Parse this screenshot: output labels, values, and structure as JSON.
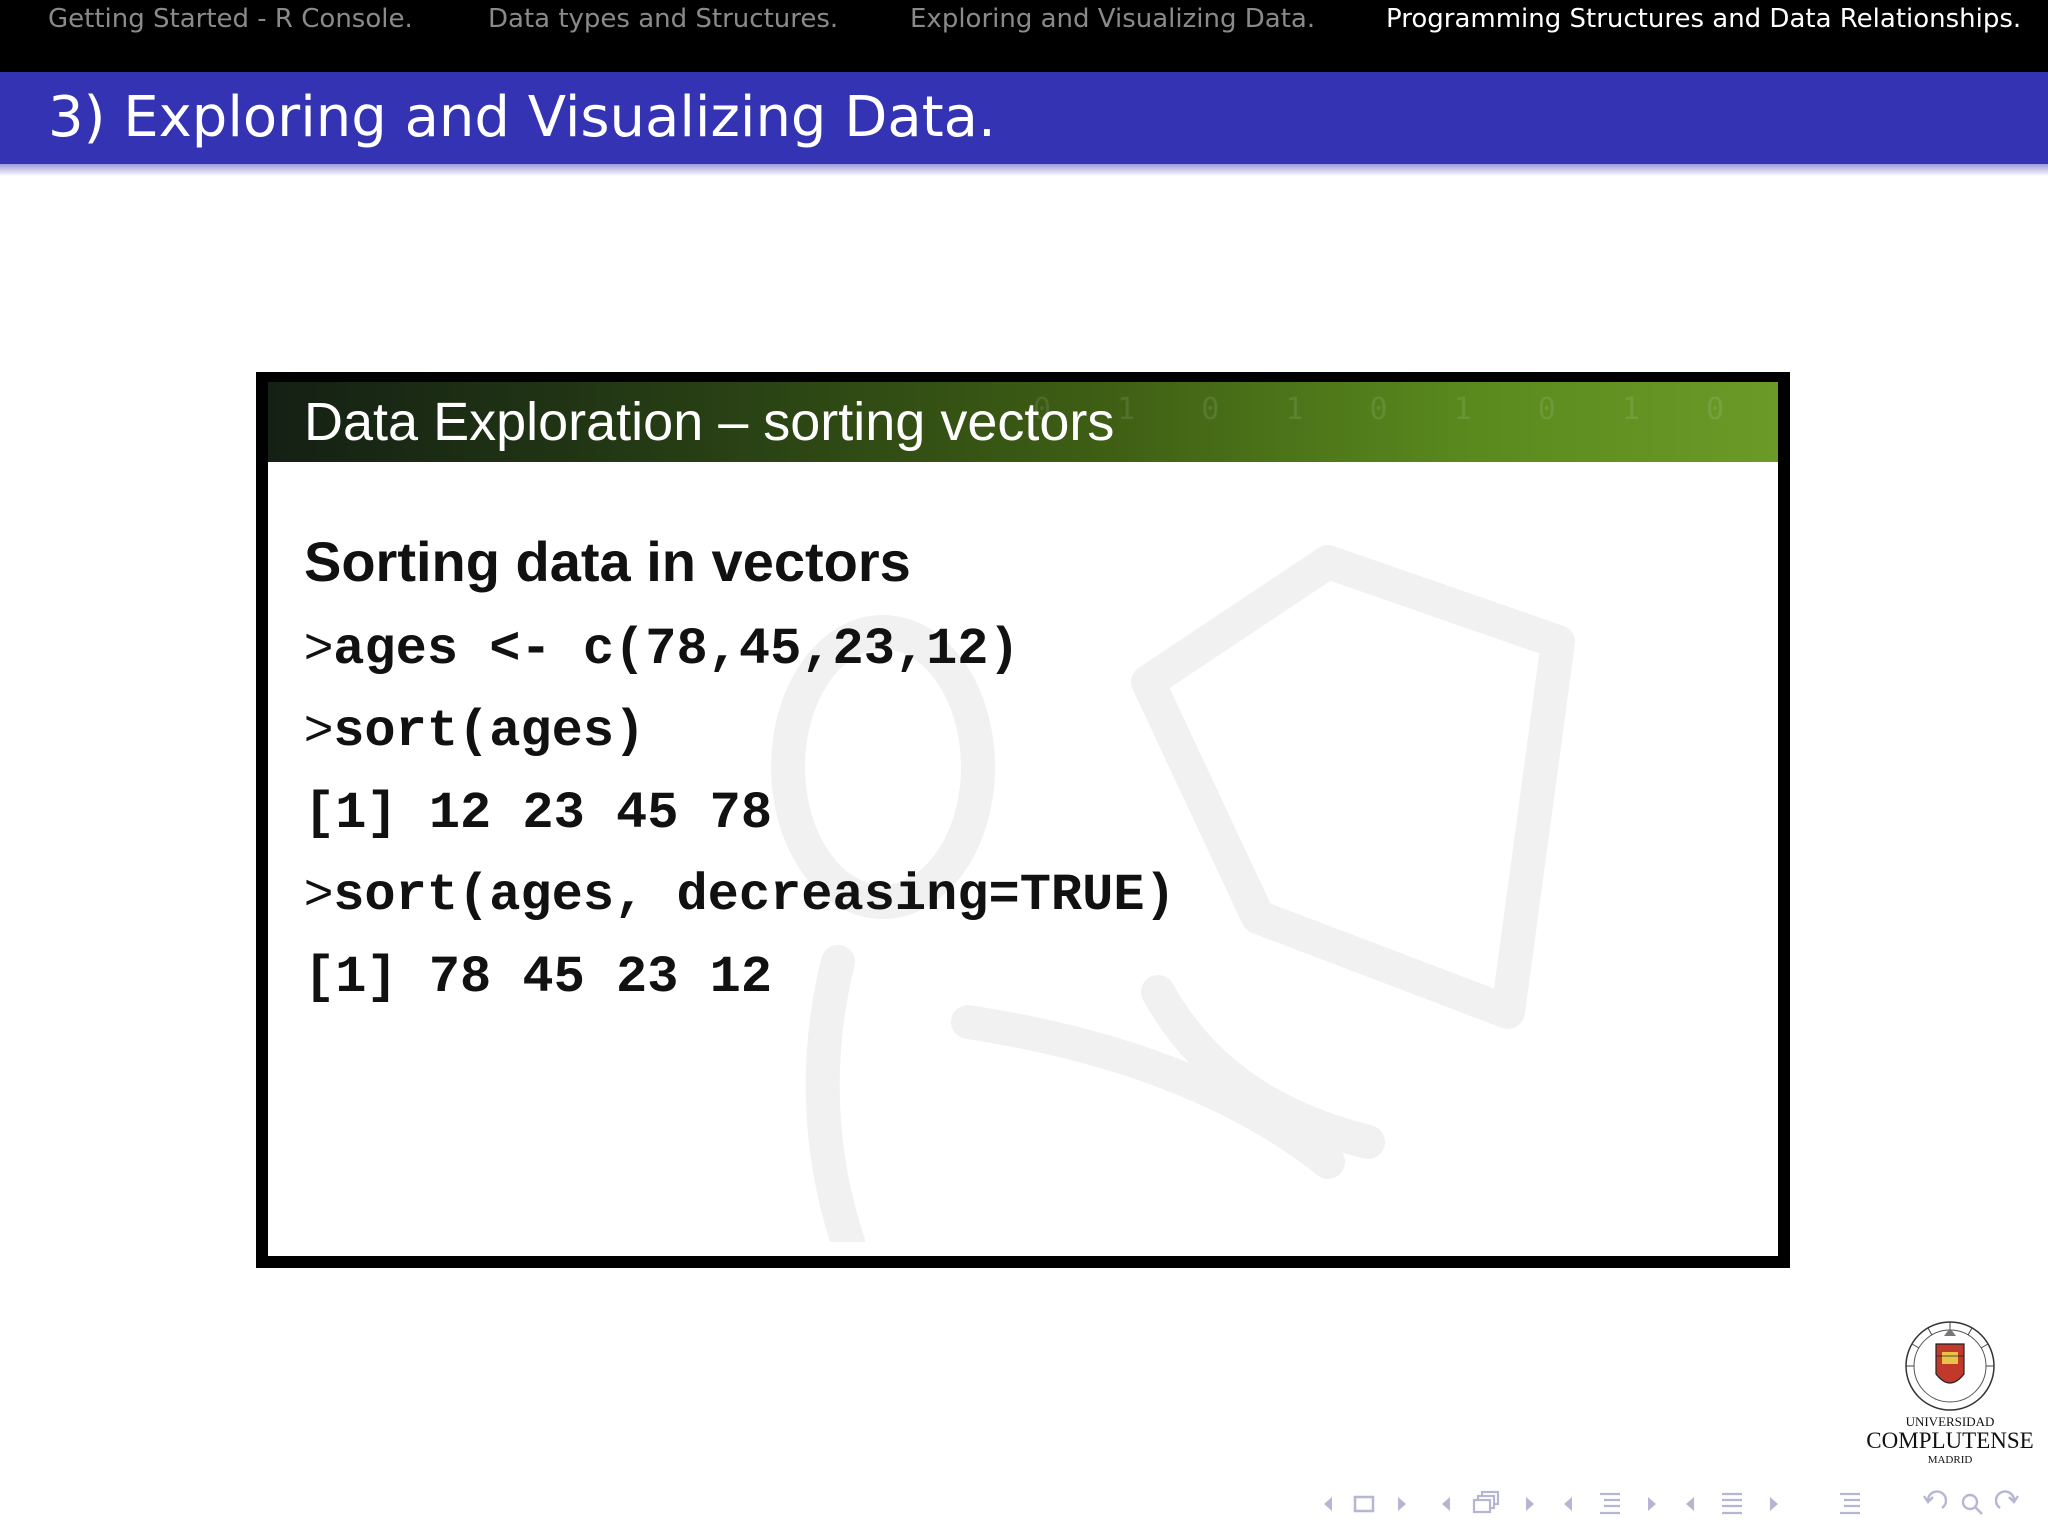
{
  "nav": {
    "sections": [
      {
        "label": "Getting Started - R Console."
      },
      {
        "label": "Data types and Structures."
      },
      {
        "label": "Exploring and Visualizing Data."
      },
      {
        "label": "Programming Structures and Data Relationships."
      }
    ],
    "active_index": 3
  },
  "frame": {
    "title": "3) Exploring and Visualizing Data."
  },
  "slide": {
    "header_title": "Data Exploration – sorting vectors",
    "heading": "Sorting data in vectors",
    "code_lines": [
      {
        "prompt": ">",
        "code": "ages <- c(78,45,23,12)"
      },
      {
        "prompt": ">",
        "code": "sort(ages)"
      },
      {
        "prompt": "",
        "code": "[1] 12 23 45 78"
      },
      {
        "prompt": ">",
        "code": "sort(ages, decreasing=TRUE)"
      },
      {
        "prompt": "",
        "code": "[1] 78 45 23 12"
      }
    ]
  },
  "logo": {
    "line1": "UNIVERSIDAD",
    "line2": "COMPLUTENSE",
    "line3": "MADRID"
  },
  "colors": {
    "nav_background": "#000000",
    "nav_inactive_text": "#8a8a8a",
    "nav_active_text": "#ffffff",
    "title_bar": "#3333b3",
    "slide_header": "#4a7018"
  },
  "nav_symbols": [
    "slide-prev-icon",
    "slide-icon",
    "slide-next-icon",
    "frame-prev-icon",
    "frame-icon",
    "frame-next-icon",
    "subsection-prev-icon",
    "subsection-icon",
    "subsection-next-icon",
    "section-prev-icon",
    "section-icon",
    "section-next-icon",
    "toc-icon",
    "back-icon",
    "search-icon",
    "forward-icon"
  ]
}
